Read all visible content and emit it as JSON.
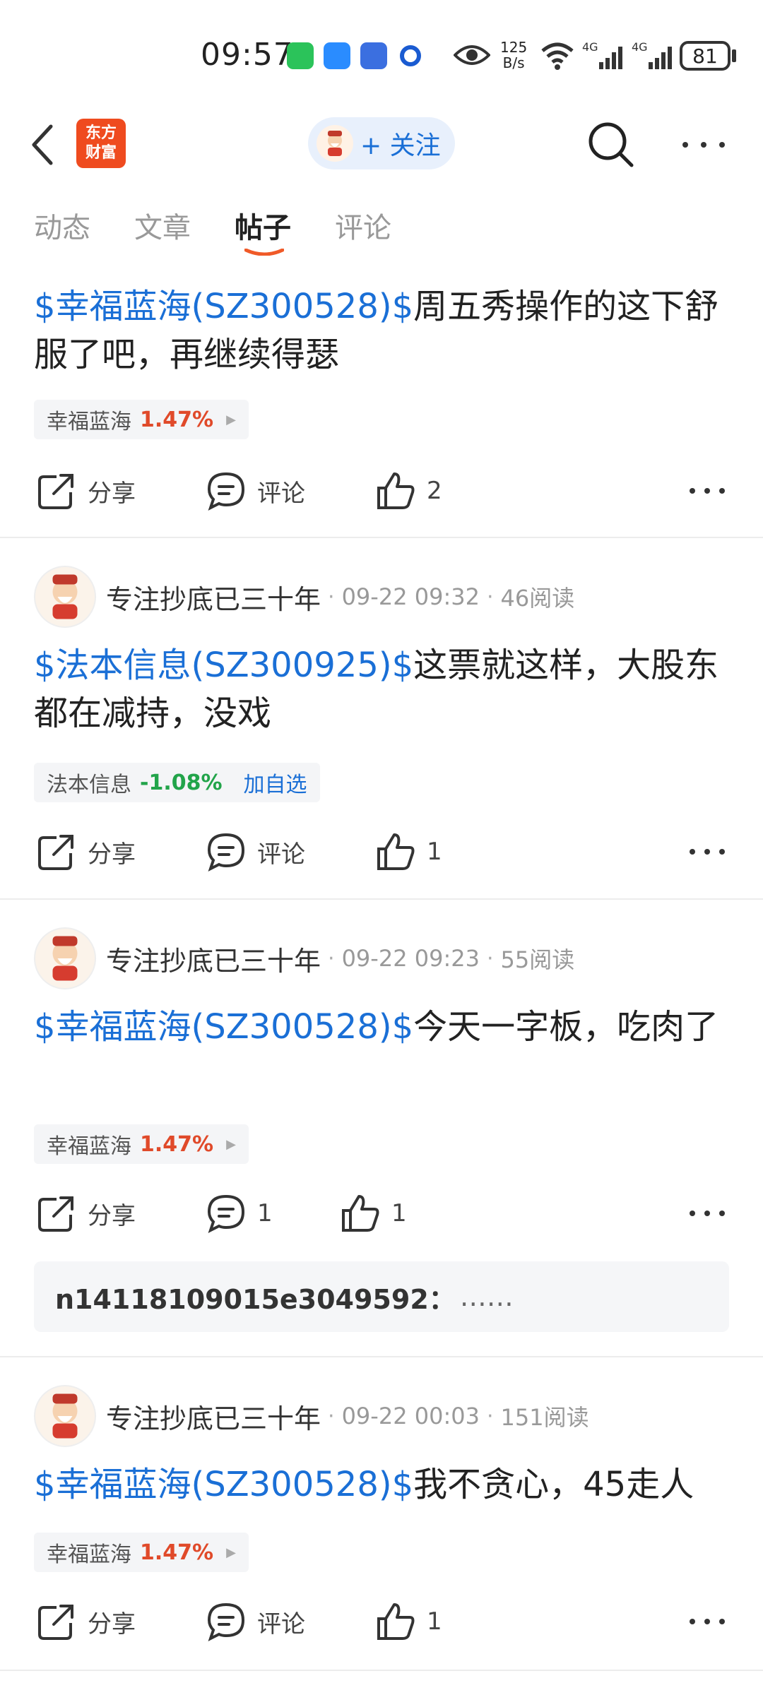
{
  "status_bar": {
    "time": "09:57",
    "net_speed_top": "125",
    "net_speed_bottom": "B/s",
    "signal1": "4G",
    "signal2": "4G",
    "battery": "81"
  },
  "header": {
    "logo_line1": "东方",
    "logo_line2": "财富",
    "follow_label": "+ 关注"
  },
  "tabs": [
    {
      "label": "动态"
    },
    {
      "label": "文章"
    },
    {
      "label": "帖子",
      "active": true
    },
    {
      "label": "评论"
    }
  ],
  "posts": [
    {
      "body_cashtag": "$幸福蓝海(SZ300528)$",
      "body_text": "周五秀操作的这下舒服了吧，再继续得瑟",
      "stock_name": "幸福蓝海",
      "stock_pct": "1.47%",
      "share_label": "分享",
      "comment_label": "评论",
      "like_count": "2"
    },
    {
      "author": "专注抄底已三十年",
      "time": "09-22 09:32",
      "reads": "46阅读",
      "body_cashtag": "$法本信息(SZ300925)$",
      "body_text": "这票就这样，大股东都在减持，没戏",
      "stock_name": "法本信息",
      "stock_pct": "-1.08%",
      "stock_add": "加自选",
      "share_label": "分享",
      "comment_label": "评论",
      "like_count": "1"
    },
    {
      "author": "专注抄底已三十年",
      "time": "09-22 09:23",
      "reads": "55阅读",
      "body_cashtag": "$幸福蓝海(SZ300528)$",
      "body_text": "今天一字板，吃肉了",
      "stock_name": "幸福蓝海",
      "stock_pct": "1.47%",
      "share_label": "分享",
      "comment_count": "1",
      "like_count": "1",
      "reply_user": "n14118109015e3049592：",
      "reply_text": "……"
    },
    {
      "author": "专注抄底已三十年",
      "time": "09-22 00:03",
      "reads": "151阅读",
      "body_cashtag": "$幸福蓝海(SZ300528)$",
      "body_text": "我不贪心，45走人",
      "stock_name": "幸福蓝海",
      "stock_pct": "1.47%",
      "share_label": "分享",
      "comment_label": "评论",
      "like_count": "1"
    }
  ],
  "colors": {
    "accent_blue": "#1a6fd6",
    "up_red": "#e04a2a",
    "down_green": "#22a44a",
    "tab_underline": "#f05a28",
    "logo": "#ef4b1f"
  }
}
